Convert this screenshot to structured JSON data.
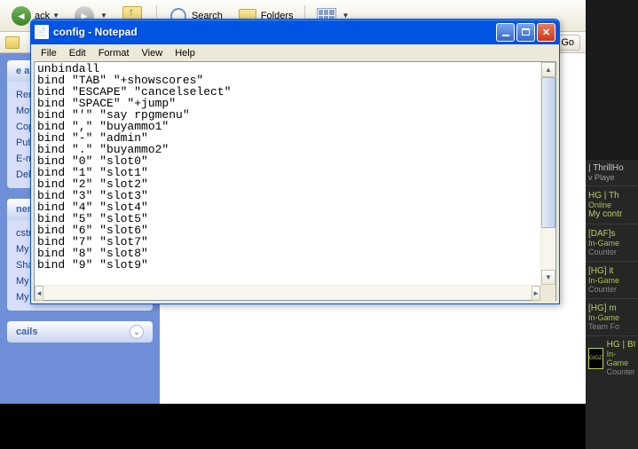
{
  "explorer": {
    "toolbar": {
      "back_label": "ack",
      "search_label": "Search",
      "folders_label": "Folders"
    },
    "addressbar": {
      "go_label": "Go"
    },
    "sidebar": {
      "tasks_header": "e and",
      "tasks": [
        "Rena",
        "Move",
        "Copy",
        "Publi",
        "E-ma",
        "Delet"
      ],
      "places_header": "ner Pl",
      "places": [
        "cstrik",
        "My D",
        "Share",
        "My Computer",
        "My Network Places"
      ],
      "details_header": "cails"
    }
  },
  "notepad": {
    "title": "config - Notepad",
    "menus": [
      "File",
      "Edit",
      "Format",
      "View",
      "Help"
    ],
    "content": "unbindall\nbind \"TAB\" \"+showscores\"\nbind \"ESCAPE\" \"cancelselect\"\nbind \"SPACE\" \"+jump\"\nbind \"'\" \"say rpgmenu\"\nbind \",\" \"buyammo1\"\nbind \"-\" \"admin\"\nbind \".\" \"buyammo2\"\nbind \"0\" \"slot0\"\nbind \"1\" \"slot1\"\nbind \"2\" \"slot2\"\nbind \"3\" \"slot3\"\nbind \"4\" \"slot4\"\nbind \"5\" \"slot5\"\nbind \"6\" \"slot6\"\nbind \"7\" \"slot7\"\nbind \"8\" \"slot8\"\nbind \"9\" \"slot9\""
  },
  "rightpanel": {
    "thrill": "| ThrillHo",
    "player": "v Playe",
    "self_name": "HG | Th",
    "self_status": "Online",
    "self_link": "My contr",
    "friends": [
      {
        "name": "[DAF]s",
        "status": "In-Game",
        "game": "Counter"
      },
      {
        "name": "[HG] it",
        "status": "In-Game",
        "game": "Counter"
      },
      {
        "name": "[HG] m",
        "status": "In-Game",
        "game": "Team Fo"
      }
    ],
    "bottom": {
      "name": "HG | BI",
      "status": "In-Game",
      "game": "Counter",
      "avatar": "GIGZ"
    }
  }
}
